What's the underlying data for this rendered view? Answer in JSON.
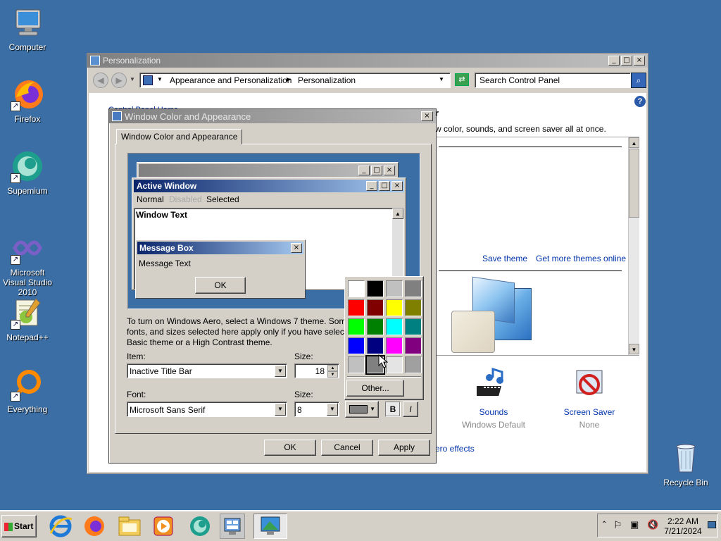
{
  "desktop": {
    "icons": [
      {
        "label": "Computer"
      },
      {
        "label": "Firefox"
      },
      {
        "label": "Supemium"
      },
      {
        "label": "Microsoft Visual Studio 2010"
      },
      {
        "label": "Notepad++"
      },
      {
        "label": "Everything"
      },
      {
        "label": "Recycle Bin"
      }
    ]
  },
  "personalization": {
    "title": "Personalization",
    "breadcrumb": [
      "Appearance and Personalization",
      "Personalization"
    ],
    "search_placeholder": "Search Control Panel",
    "left_link": "Control Panel Home",
    "heading_fragment": "r",
    "subtitle_fragment": "w color, sounds, and screen saver all at once.",
    "save_theme": "Save theme",
    "get_more_themes": "Get more themes online",
    "sounds_label": "Sounds",
    "sounds_value": "Windows Default",
    "screensaver_label": "Screen Saver",
    "screensaver_value": "None",
    "aero_fragment": "ero effects"
  },
  "dialog": {
    "title": "Window Color and Appearance",
    "tab": "Window Color and Appearance",
    "preview": {
      "active_window": "Active Window",
      "menu_normal": "Normal",
      "menu_disabled": "Disabled",
      "menu_selected": "Selected",
      "window_text": "Window Text",
      "message_box": "Message Box",
      "message_text": "Message Text",
      "ok": "OK"
    },
    "description_line1": "To turn on Windows Aero, select a Windows 7 theme.  Som",
    "description_line2": "fonts, and sizes selected here apply only if you have selecte",
    "description_line3": "Basic theme or a High Contrast theme.",
    "item_label": "Item:",
    "item_value": "Inactive Title Bar",
    "size_label": "Size:",
    "size_value": "18",
    "font_label": "Font:",
    "font_value": "Microsoft Sans Serif",
    "font_size_label": "Size:",
    "font_size_value": "8",
    "bold": "B",
    "italic": "I",
    "ok": "OK",
    "cancel": "Cancel",
    "apply": "Apply",
    "other_button": "Other...",
    "palette": [
      "#ffffff",
      "#000000",
      "#c0c0c0",
      "#808080",
      "#ff0000",
      "#800000",
      "#ffff00",
      "#808000",
      "#00ff00",
      "#008000",
      "#00ffff",
      "#008080",
      "#0000ff",
      "#000080",
      "#ff00ff",
      "#800080",
      "#c0c0c0",
      "#808080",
      "#e4e4e4",
      "#a0a0a0"
    ],
    "selected_color": "#808080"
  },
  "taskbar": {
    "start": "Start",
    "time": "2:22 AM",
    "date": "7/21/2024"
  }
}
